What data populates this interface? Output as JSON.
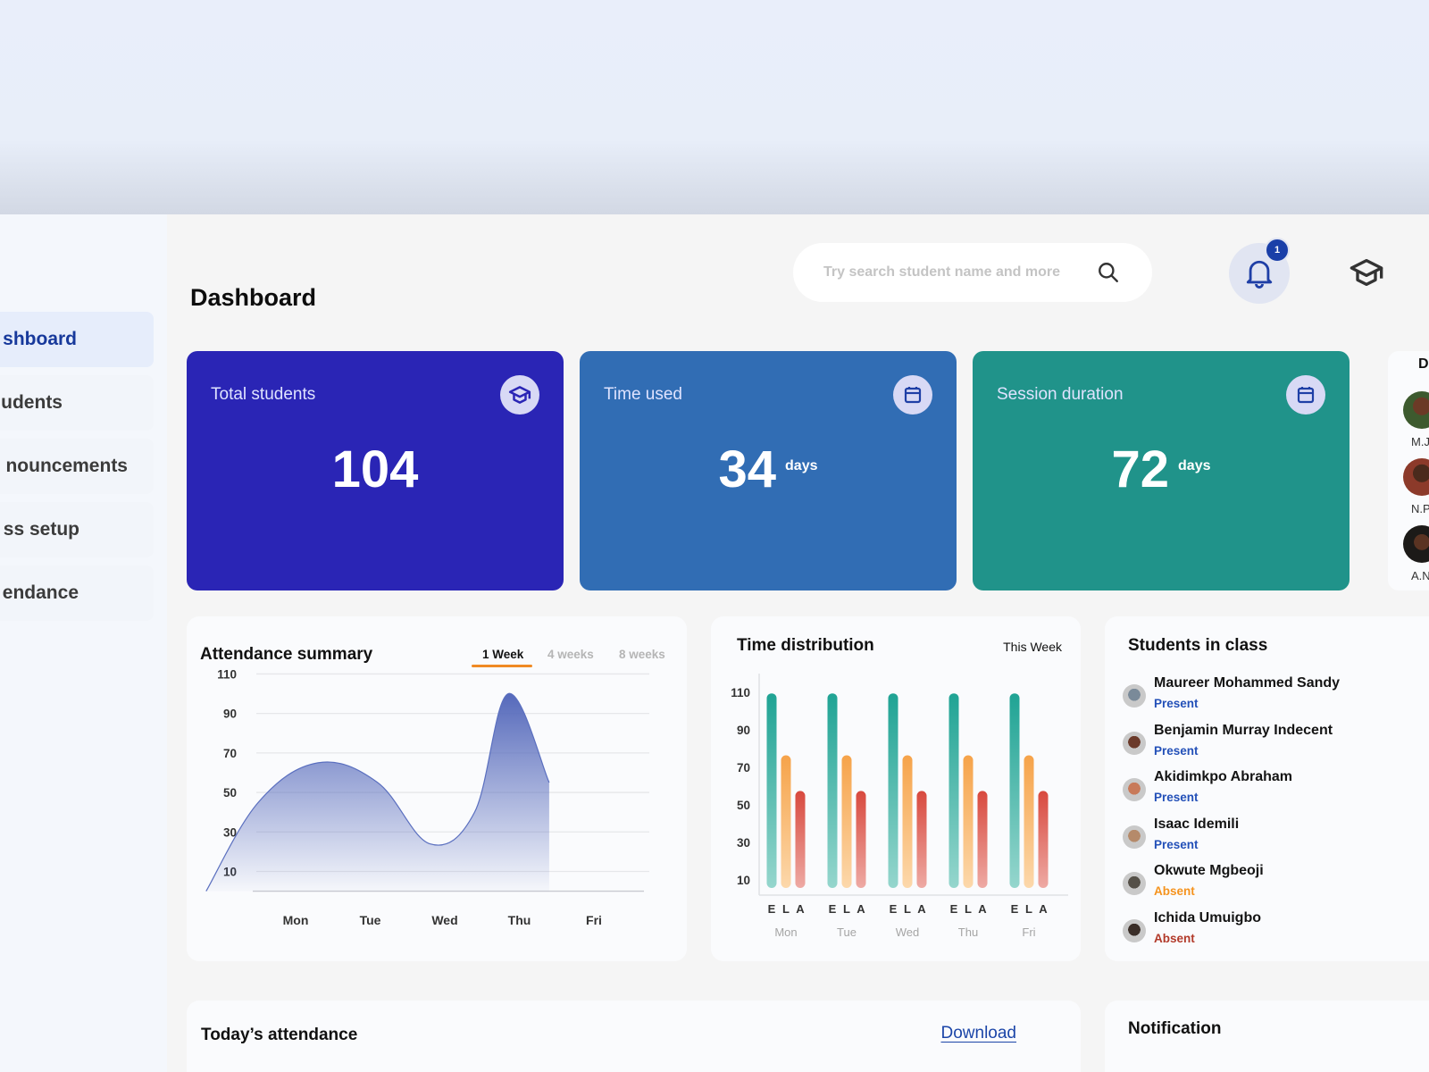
{
  "sidebar": {
    "items": [
      {
        "label": "Dashboard",
        "visible_label": "shboard",
        "active": true
      },
      {
        "label": "Students",
        "visible_label": "udents",
        "active": false
      },
      {
        "label": "Announcements",
        "visible_label": "nouncements",
        "active": false
      },
      {
        "label": "Class setup",
        "visible_label": "ss setup",
        "active": false
      },
      {
        "label": "Attendance",
        "visible_label": "endance",
        "active": false
      }
    ]
  },
  "header": {
    "title": "Dashboard",
    "search_placeholder": "Try search student name and more",
    "search_value": "",
    "notification_count": "1",
    "icons": [
      "search-icon",
      "bell-icon",
      "graduation-cap-icon"
    ]
  },
  "stats": [
    {
      "label": "Total students",
      "value": "104",
      "unit": "",
      "icon": "graduation-cap-icon",
      "color": "#2a25b5"
    },
    {
      "label": "Time used",
      "value": "34",
      "unit": "days",
      "icon": "calendar-icon",
      "color": "#316db4"
    },
    {
      "label": "Session duration",
      "value": "72",
      "unit": "days",
      "icon": "calendar-icon",
      "color": "#20938a"
    }
  ],
  "partial_card": {
    "title_fragment": "Da",
    "people": [
      {
        "initials": "M.J"
      },
      {
        "initials": "N.P"
      },
      {
        "initials": "A.N"
      }
    ]
  },
  "attendance_summary": {
    "title": "Attendance summary",
    "tabs": [
      {
        "label": "1 Week",
        "active": true
      },
      {
        "label": "4 weeks",
        "active": false
      },
      {
        "label": "8 weeks",
        "active": false
      }
    ],
    "accent_color": "#f08a24"
  },
  "time_distribution": {
    "title": "Time distribution",
    "period": "This Week"
  },
  "students_in_class": {
    "title": "Students in class",
    "students": [
      {
        "name": "Maureer Mohammed Sandy",
        "status": "Present",
        "status_color": "#2350b8"
      },
      {
        "name": "Benjamin Murray Indecent",
        "status": "Present",
        "status_color": "#2350b8"
      },
      {
        "name": "Akidimkpo Abraham",
        "status": "Present",
        "status_color": "#2350b8"
      },
      {
        "name": "Isaac Idemili",
        "status": "Present",
        "status_color": "#2350b8"
      },
      {
        "name": "Okwute Mgbeoji",
        "status": "Absent",
        "status_color": "#f5931e"
      },
      {
        "name": "Ichida Umuigbo",
        "status": "Absent",
        "status_color": "#b23a2a"
      }
    ]
  },
  "todays_attendance": {
    "title": "Today’s attendance",
    "download_label": "Download"
  },
  "notification_panel": {
    "title": "Notification"
  },
  "chart_data": [
    {
      "type": "area",
      "title": "Attendance summary",
      "categories": [
        "Mon",
        "Tue",
        "Wed",
        "Thu",
        "Fri"
      ],
      "yticks": [
        10,
        30,
        50,
        70,
        90,
        110
      ],
      "ylim": [
        -2,
        112
      ],
      "grid": true,
      "series": [
        {
          "name": "Attendance",
          "points": [
            [
              -1.2,
              0
            ],
            [
              -0.5,
              45
            ],
            [
              0.3,
              65
            ],
            [
              1.1,
              55
            ],
            [
              1.8,
              24
            ],
            [
              2.4,
              40
            ],
            [
              2.85,
              100
            ],
            [
              3.4,
              55
            ]
          ]
        }
      ],
      "color": "#5569bb"
    },
    {
      "type": "bar",
      "title": "Time distribution",
      "categories": [
        "Mon",
        "Tue",
        "Wed",
        "Thu",
        "Fri"
      ],
      "sub_labels": [
        "E",
        "L",
        "A"
      ],
      "yticks": [
        10,
        30,
        50,
        70,
        90,
        110
      ],
      "ylim": [
        0,
        125
      ],
      "series": [
        {
          "name": "E",
          "values": [
            108,
            108,
            108,
            108,
            108
          ],
          "color_top": "#1fa394",
          "color_bottom": "#95d6cd"
        },
        {
          "name": "L",
          "values": [
            75,
            75,
            75,
            75,
            75
          ],
          "color_top": "#f6a34a",
          "color_bottom": "#fcd8ab"
        },
        {
          "name": "A",
          "values": [
            56,
            56,
            56,
            56,
            56
          ],
          "color_top": "#d8493e",
          "color_bottom": "#eeaaa4"
        }
      ]
    }
  ]
}
